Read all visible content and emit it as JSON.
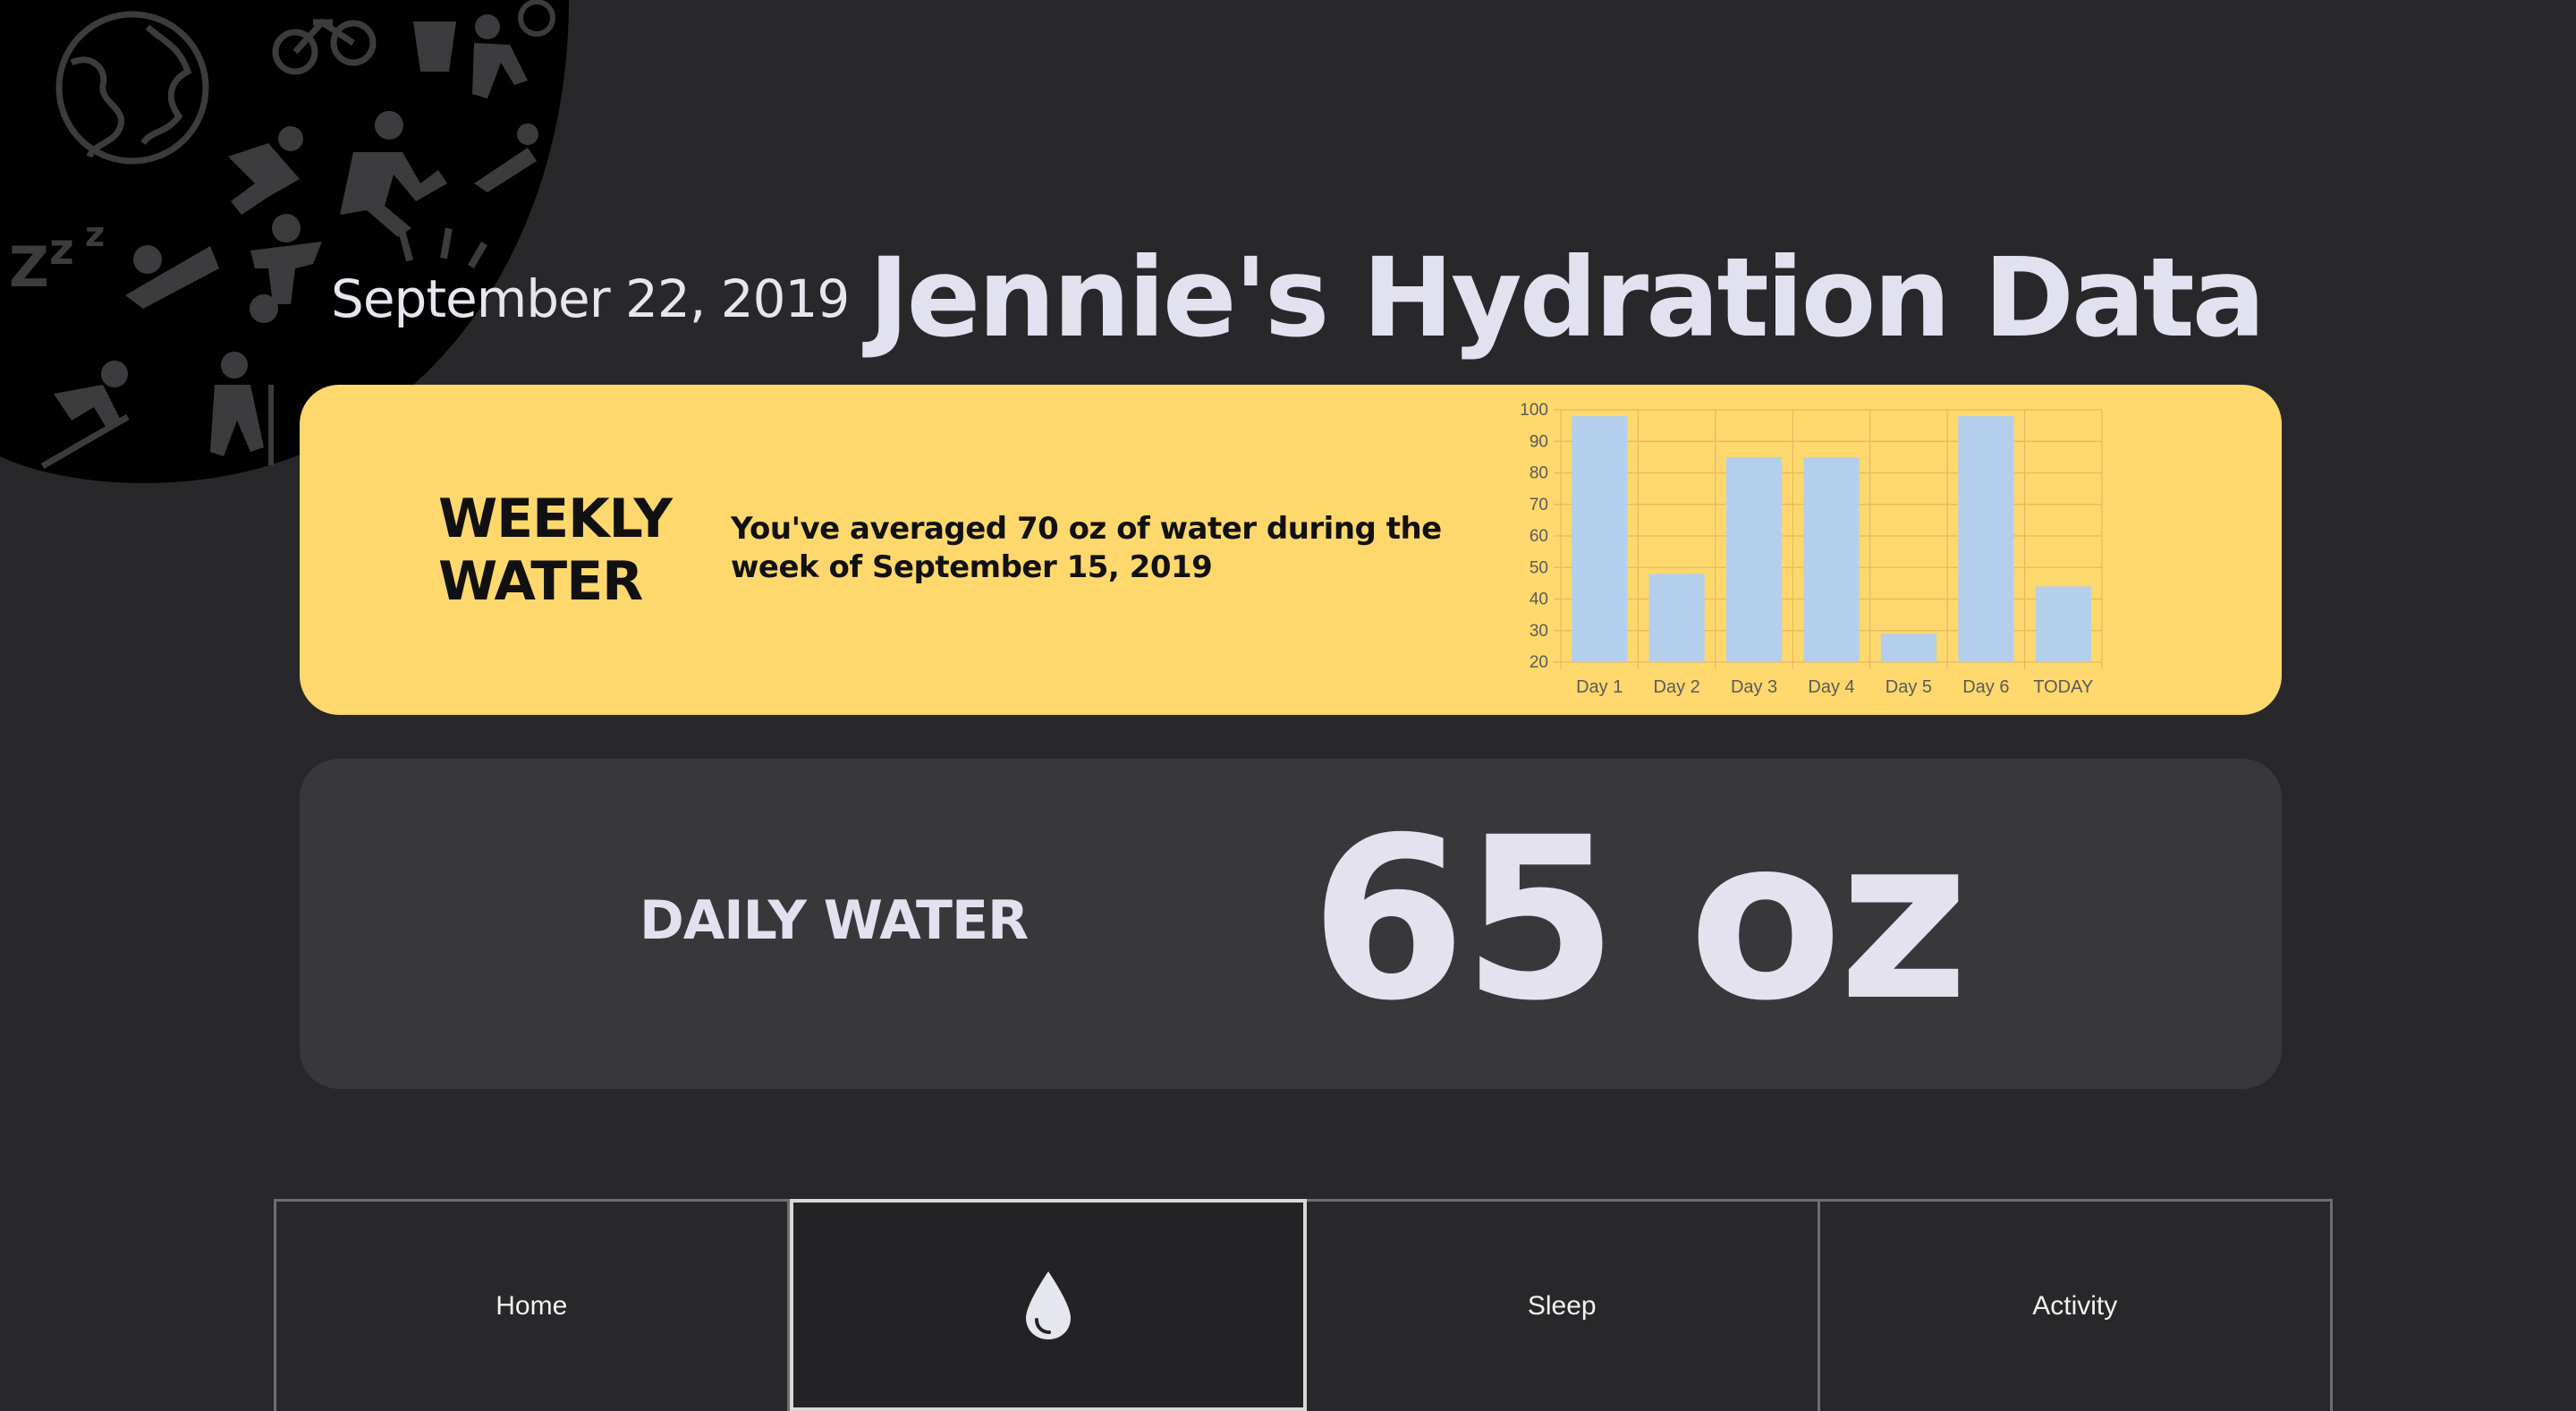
{
  "header": {
    "date": "September 22, 2019",
    "title": "Jennie's Hydration Data"
  },
  "weekly": {
    "title_line1": "WEEKLY",
    "title_line2": "WATER",
    "summary": "You've averaged 70 oz of water during the week of September 15, 2019"
  },
  "chart_data": {
    "type": "bar",
    "categories": [
      "Day 1",
      "Day 2",
      "Day 3",
      "Day 4",
      "Day 5",
      "Day 6",
      "TODAY"
    ],
    "values": [
      98,
      48,
      85,
      85,
      29,
      98,
      44
    ],
    "ylim": [
      20,
      100
    ],
    "yticks": [
      20,
      30,
      40,
      50,
      60,
      70,
      80,
      90,
      100
    ],
    "grid": true,
    "bar_color": "#b4cfeb",
    "grid_color": "#e3b962",
    "axis_text_color": "#5a5a5a"
  },
  "daily": {
    "label": "DAILY WATER",
    "value": "65 oz"
  },
  "nav": {
    "tabs": [
      {
        "label": "Home",
        "icon": ""
      },
      {
        "label": "",
        "icon": "water-drop-icon"
      },
      {
        "label": "Sleep",
        "icon": ""
      },
      {
        "label": "Activity",
        "icon": ""
      }
    ],
    "active_index": 1
  },
  "colors": {
    "background": "#28282b",
    "weekly_card": "#fed86d",
    "daily_card": "#38383b",
    "text_light": "#e4e2ef"
  },
  "decoration": {
    "icons": [
      "globe-icon",
      "bicycle-icon",
      "cup-icon",
      "volleyball-icon",
      "running-icon",
      "falling-icon",
      "sleeping-icon",
      "bed-icon",
      "soccer-icon",
      "skiing-icon",
      "hiking-icon"
    ]
  }
}
